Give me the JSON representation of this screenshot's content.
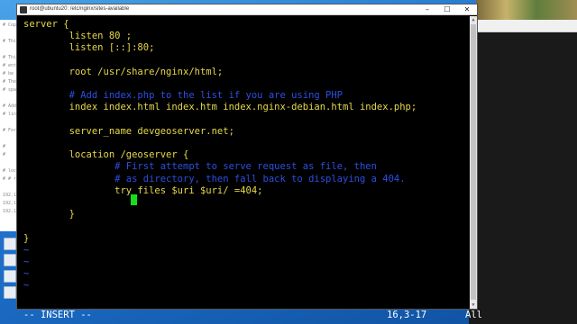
{
  "window": {
    "title": "root@ubuntu20: /etc/nginx/sites-available",
    "controls": {
      "minimize": "–",
      "maximize": "☐",
      "close": "✕"
    }
  },
  "editor": {
    "lines": [
      {
        "text": "server {",
        "style": "code"
      },
      {
        "text": "        listen 80 ;",
        "style": "code"
      },
      {
        "text": "        listen [::]:80;",
        "style": "code"
      },
      {
        "text": "",
        "style": "code"
      },
      {
        "text": "        root /usr/share/nginx/html;",
        "style": "code"
      },
      {
        "text": "",
        "style": "code"
      },
      {
        "text": "        # Add index.php to the list if you are using PHP",
        "style": "comment"
      },
      {
        "text": "        index index.html index.htm index.nginx-debian.html index.php;",
        "style": "code"
      },
      {
        "text": "",
        "style": "code"
      },
      {
        "text": "        server_name devgeoserver.net;",
        "style": "code"
      },
      {
        "text": "",
        "style": "code"
      },
      {
        "text": "        location /geoserver {",
        "style": "code"
      },
      {
        "text": "                # First attempt to serve request as file, then",
        "style": "comment"
      },
      {
        "text": "                # as directory, then fall back to displaying a 404.",
        "style": "comment"
      },
      {
        "text": "                try_files $uri $uri/ =404;",
        "style": "code"
      },
      {
        "text": "",
        "style": "code"
      },
      {
        "text": "        }",
        "style": "code"
      },
      {
        "text": "",
        "style": "code"
      },
      {
        "text": "}",
        "style": "code"
      },
      {
        "text": "~",
        "style": "tilde"
      },
      {
        "text": "~",
        "style": "tilde"
      },
      {
        "text": "~",
        "style": "tilde"
      },
      {
        "text": "~",
        "style": "tilde"
      }
    ]
  },
  "statusbar": {
    "mode": "-- INSERT --",
    "position": "16,3-17",
    "scroll": "All"
  },
  "background_window": {
    "lines": [
      "# Copy",
      "",
      "# This",
      "",
      "# This",
      "# entr",
      "# be",
      "# The",
      "# spa",
      "",
      "# Add",
      "# line",
      "",
      "# For",
      "",
      "#",
      "#",
      "",
      "# loc",
      "# # ro",
      "",
      "192.1",
      "192.1",
      "192.1"
    ]
  },
  "colors": {
    "code": "#e6d84a",
    "comment": "#2d4fe0",
    "tilde": "#3a5bdc",
    "cursor": "#14e01a"
  }
}
